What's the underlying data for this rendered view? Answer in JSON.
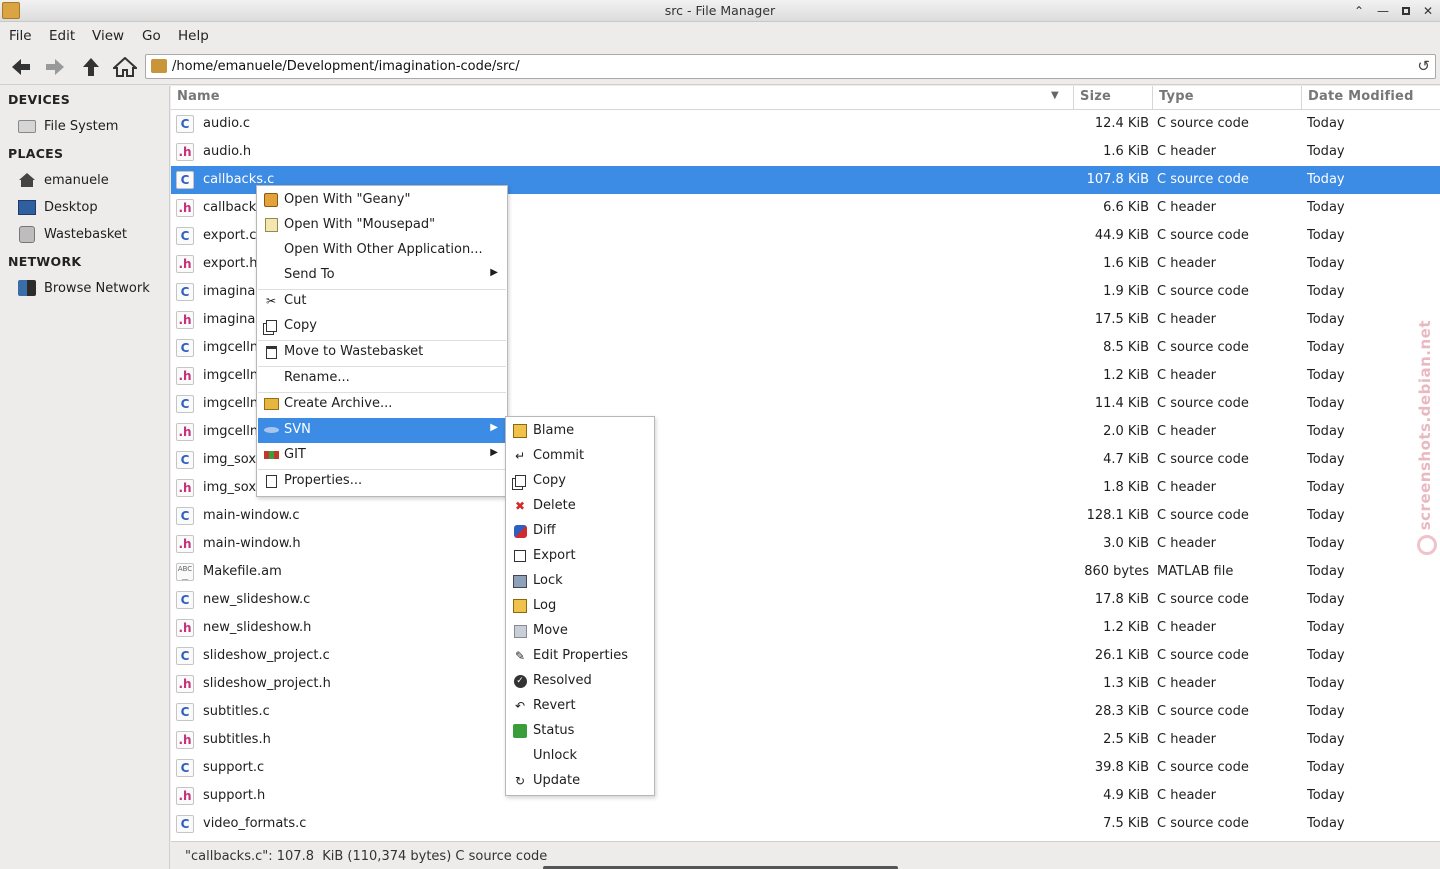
{
  "window": {
    "title": "src - File Manager"
  },
  "menubar": [
    "File",
    "Edit",
    "View",
    "Go",
    "Help"
  ],
  "location": {
    "path": "/home/emanuele/Development/imagination-code/src/"
  },
  "sidebar": {
    "sections": [
      {
        "title": "DEVICES",
        "items": [
          {
            "label": "File System",
            "icon": "drive-icon"
          }
        ]
      },
      {
        "title": "PLACES",
        "items": [
          {
            "label": "emanuele",
            "icon": "home-icon"
          },
          {
            "label": "Desktop",
            "icon": "desktop-icon"
          },
          {
            "label": "Wastebasket",
            "icon": "trash-icon"
          }
        ]
      },
      {
        "title": "NETWORK",
        "items": [
          {
            "label": "Browse Network",
            "icon": "network-icon"
          }
        ]
      }
    ]
  },
  "columns": {
    "name": "Name",
    "size": "Size",
    "type": "Type",
    "date": "Date Modified"
  },
  "files": [
    {
      "name": "audio.c",
      "size": "12.4  KiB",
      "type": "C source code",
      "date": "Today",
      "kind": "c"
    },
    {
      "name": "audio.h",
      "size": "1.6  KiB",
      "type": "C header",
      "date": "Today",
      "kind": "h"
    },
    {
      "name": "callbacks.c",
      "size": "107.8  KiB",
      "type": "C source code",
      "date": "Today",
      "kind": "c",
      "selected": true
    },
    {
      "name": "callback",
      "size": "6.6  KiB",
      "type": "C header",
      "date": "Today",
      "kind": "h"
    },
    {
      "name": "export.c",
      "size": "44.9  KiB",
      "type": "C source code",
      "date": "Today",
      "kind": "c"
    },
    {
      "name": "export.h",
      "size": "1.6  KiB",
      "type": "C header",
      "date": "Today",
      "kind": "h"
    },
    {
      "name": "imagina",
      "size": "1.9  KiB",
      "type": "C source code",
      "date": "Today",
      "kind": "c"
    },
    {
      "name": "imagina",
      "size": "17.5  KiB",
      "type": "C header",
      "date": "Today",
      "kind": "h"
    },
    {
      "name": "imgcelln",
      "size": "8.5  KiB",
      "type": "C source code",
      "date": "Today",
      "kind": "c"
    },
    {
      "name": "imgcelln",
      "size": "1.2  KiB",
      "type": "C header",
      "date": "Today",
      "kind": "h"
    },
    {
      "name": "imgcelln",
      "size": "11.4  KiB",
      "type": "C source code",
      "date": "Today",
      "kind": "c"
    },
    {
      "name": "imgcelln",
      "size": "2.0  KiB",
      "type": "C header",
      "date": "Today",
      "kind": "h"
    },
    {
      "name": "img_sox",
      "size": "4.7  KiB",
      "type": "C source code",
      "date": "Today",
      "kind": "c"
    },
    {
      "name": "img_sox",
      "size": "1.8  KiB",
      "type": "C header",
      "date": "Today",
      "kind": "h"
    },
    {
      "name": "main-window.c",
      "size": "128.1  KiB",
      "type": "C source code",
      "date": "Today",
      "kind": "c"
    },
    {
      "name": "main-window.h",
      "size": "3.0  KiB",
      "type": "C header",
      "date": "Today",
      "kind": "h"
    },
    {
      "name": "Makefile.am",
      "size": "860 bytes",
      "type": "MATLAB file",
      "date": "Today",
      "kind": "abc"
    },
    {
      "name": "new_slideshow.c",
      "size": "17.8  KiB",
      "type": "C source code",
      "date": "Today",
      "kind": "c"
    },
    {
      "name": "new_slideshow.h",
      "size": "1.2  KiB",
      "type": "C header",
      "date": "Today",
      "kind": "h"
    },
    {
      "name": "slideshow_project.c",
      "size": "26.1  KiB",
      "type": "C source code",
      "date": "Today",
      "kind": "c"
    },
    {
      "name": "slideshow_project.h",
      "size": "1.3  KiB",
      "type": "C header",
      "date": "Today",
      "kind": "h"
    },
    {
      "name": "subtitles.c",
      "size": "28.3  KiB",
      "type": "C source code",
      "date": "Today",
      "kind": "c"
    },
    {
      "name": "subtitles.h",
      "size": "2.5  KiB",
      "type": "C header",
      "date": "Today",
      "kind": "h"
    },
    {
      "name": "support.c",
      "size": "39.8  KiB",
      "type": "C source code",
      "date": "Today",
      "kind": "c"
    },
    {
      "name": "support.h",
      "size": "4.9  KiB",
      "type": "C header",
      "date": "Today",
      "kind": "h"
    },
    {
      "name": "video_formats.c",
      "size": "7.5  KiB",
      "type": "C source code",
      "date": "Today",
      "kind": "c"
    }
  ],
  "context_menu": [
    {
      "label": "Open With \"Geany\"",
      "icon": "geany-icon"
    },
    {
      "label": "Open With \"Mousepad\"",
      "icon": "mousepad-icon"
    },
    {
      "label": "Open With Other Application...",
      "icon": ""
    },
    {
      "label": "Send To",
      "icon": "",
      "submenu": true,
      "divider_after": true
    },
    {
      "label": "Cut",
      "icon": "scissors-icon"
    },
    {
      "label": "Copy",
      "icon": "copy-icon",
      "divider_after": true
    },
    {
      "label": "Move to Wastebasket",
      "icon": "trash-icon",
      "divider_after": true
    },
    {
      "label": "Rename...",
      "icon": "",
      "divider_after": true
    },
    {
      "label": "Create Archive...",
      "icon": "archive-icon",
      "divider_after": true
    },
    {
      "label": "SVN",
      "icon": "svn-icon",
      "submenu": true,
      "highlighted": true
    },
    {
      "label": "GIT",
      "icon": "git-icon",
      "submenu": true,
      "divider_after": true
    },
    {
      "label": "Properties...",
      "icon": "properties-icon"
    }
  ],
  "svn_submenu": [
    {
      "label": "Blame",
      "icon": "blame-icon"
    },
    {
      "label": "Commit",
      "icon": "commit-icon"
    },
    {
      "label": "Copy",
      "icon": "copy-icon"
    },
    {
      "label": "Delete",
      "icon": "delete-icon"
    },
    {
      "label": "Diff",
      "icon": "diff-icon"
    },
    {
      "label": "Export",
      "icon": "export-icon"
    },
    {
      "label": "Lock",
      "icon": "lock-icon"
    },
    {
      "label": "Log",
      "icon": "log-icon"
    },
    {
      "label": "Move",
      "icon": "move-icon"
    },
    {
      "label": "Edit Properties",
      "icon": "edit-properties-icon"
    },
    {
      "label": "Resolved",
      "icon": "resolved-icon"
    },
    {
      "label": "Revert",
      "icon": "revert-icon"
    },
    {
      "label": "Status",
      "icon": "status-icon"
    },
    {
      "label": "Unlock",
      "icon": ""
    },
    {
      "label": "Update",
      "icon": "update-icon"
    }
  ],
  "status": {
    "text": "\"callbacks.c\": 107.8  KiB (110,374 bytes) C source code"
  },
  "watermark": "screenshots.debian.net",
  "colors": {
    "selection": "#3c8be4",
    "c_icon": "#2f5fbf",
    "h_icon": "#c4327a"
  }
}
